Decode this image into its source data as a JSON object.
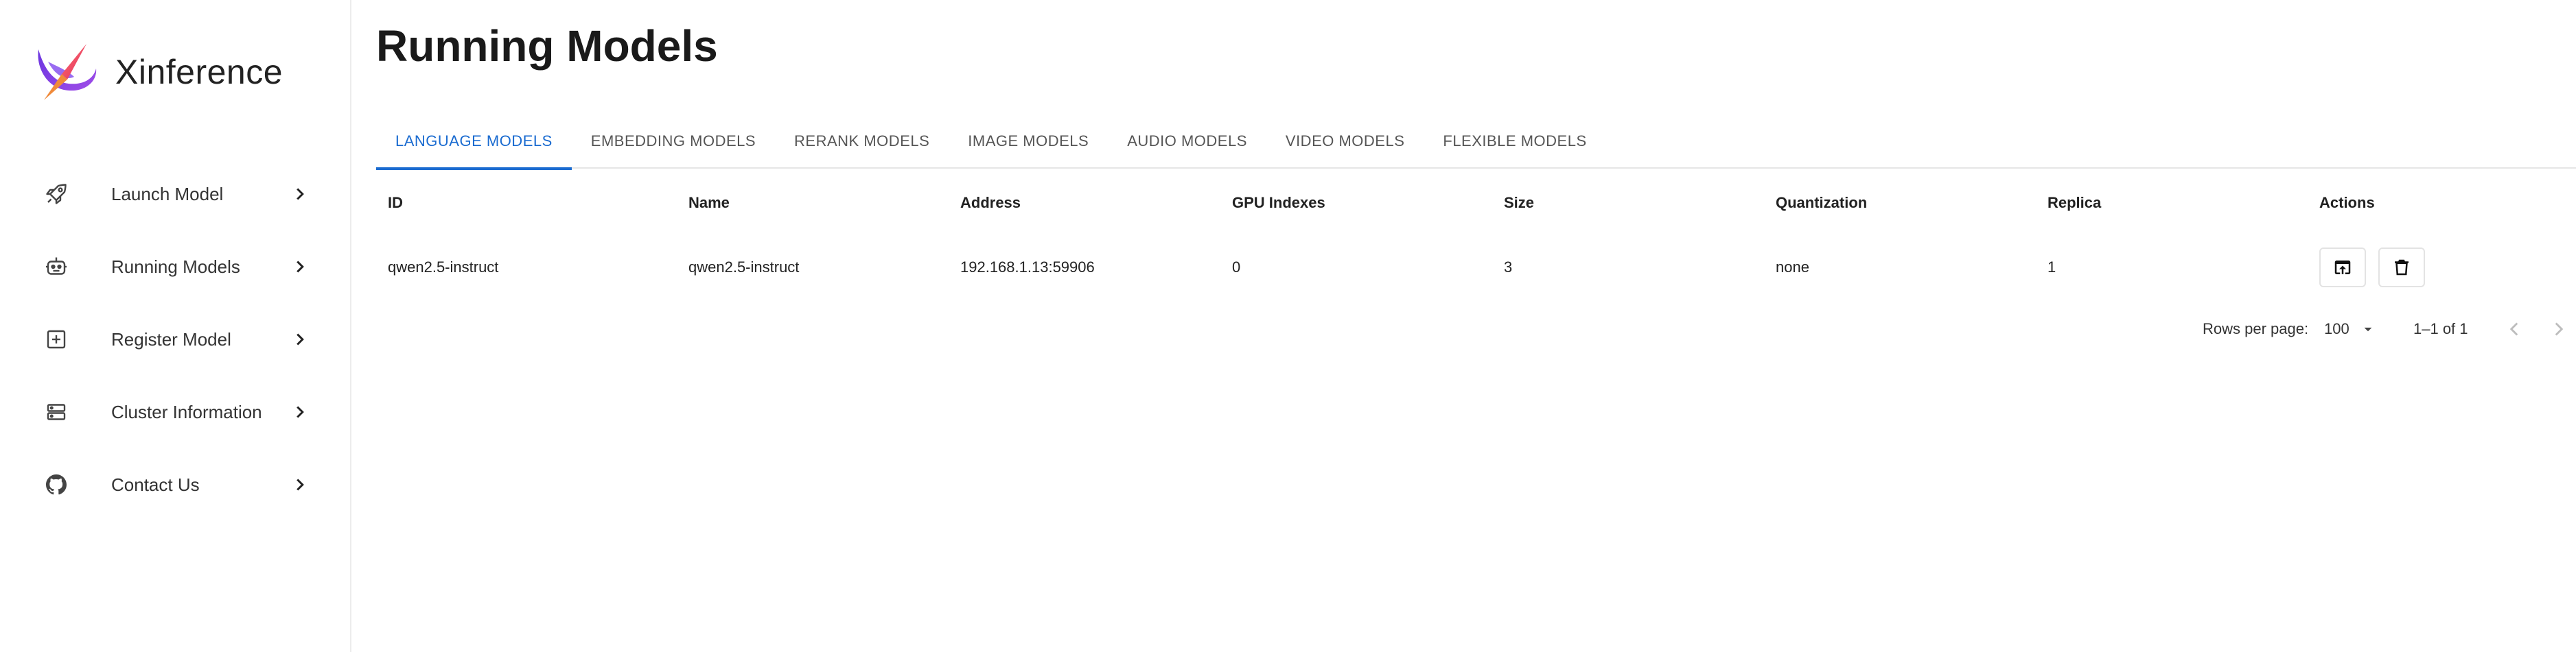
{
  "brand": {
    "name": "Xinference"
  },
  "sidebar": {
    "items": [
      {
        "label": "Launch Model",
        "icon": "rocket-icon"
      },
      {
        "label": "Running Models",
        "icon": "robot-icon"
      },
      {
        "label": "Register Model",
        "icon": "add-box-icon"
      },
      {
        "label": "Cluster Information",
        "icon": "storage-icon"
      },
      {
        "label": "Contact Us",
        "icon": "github-icon"
      }
    ]
  },
  "page": {
    "title": "Running Models"
  },
  "tabs": [
    {
      "label": "LANGUAGE MODELS",
      "active": true
    },
    {
      "label": "EMBEDDING MODELS"
    },
    {
      "label": "RERANK MODELS"
    },
    {
      "label": "IMAGE MODELS"
    },
    {
      "label": "AUDIO MODELS"
    },
    {
      "label": "VIDEO MODELS"
    },
    {
      "label": "FLEXIBLE MODELS"
    }
  ],
  "table": {
    "columns": [
      "ID",
      "Name",
      "Address",
      "GPU Indexes",
      "Size",
      "Quantization",
      "Replica",
      "Actions"
    ],
    "rows": [
      [
        "qwen2.5-instruct",
        "qwen2.5-instruct",
        "192.168.1.13:59906",
        "0",
        "3",
        "none",
        "1"
      ]
    ]
  },
  "pagination": {
    "rows_per_page_label": "Rows per page:",
    "rows_per_page": "100",
    "range": "1–1 of 1"
  },
  "colors": {
    "accent": "#1a6bd0",
    "logo_start": "#7b3fe4",
    "logo_end": "#e8447a"
  }
}
